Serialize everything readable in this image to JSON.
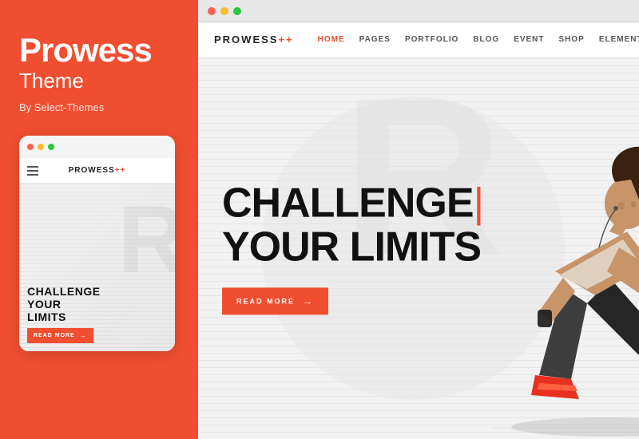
{
  "leftPanel": {
    "title": "Prowess",
    "subtitle": "Theme",
    "author": "By Select-Themes"
  },
  "mobilePreview": {
    "logo": "PROWESS",
    "logoPlus": "++",
    "heroText": [
      "CHALLENGE",
      "YOUR",
      "LIMITS"
    ],
    "readMoreLabel": "READ MORE",
    "bigLetter": "R"
  },
  "browserPreview": {
    "logo": "PROWESS",
    "logoPlus": "++",
    "nav": {
      "links": [
        "HOME",
        "PAGES",
        "PORTFOLIO",
        "BLOG",
        "EVENT",
        "SHOP",
        "ELEMENTS"
      ],
      "activeIndex": 0
    },
    "hero": {
      "headline1": "CHALLENGE",
      "headline2": "YOUR LIMITS",
      "cursor": "|",
      "readMoreLabel": "READ MORE"
    }
  },
  "dots": {
    "red": "dot-red",
    "yellow": "dot-yellow",
    "green": "dot-green"
  },
  "colors": {
    "accent": "#f04e30",
    "dark": "#111111",
    "navBg": "#ffffff",
    "heroBg": "#f2f2f2"
  }
}
